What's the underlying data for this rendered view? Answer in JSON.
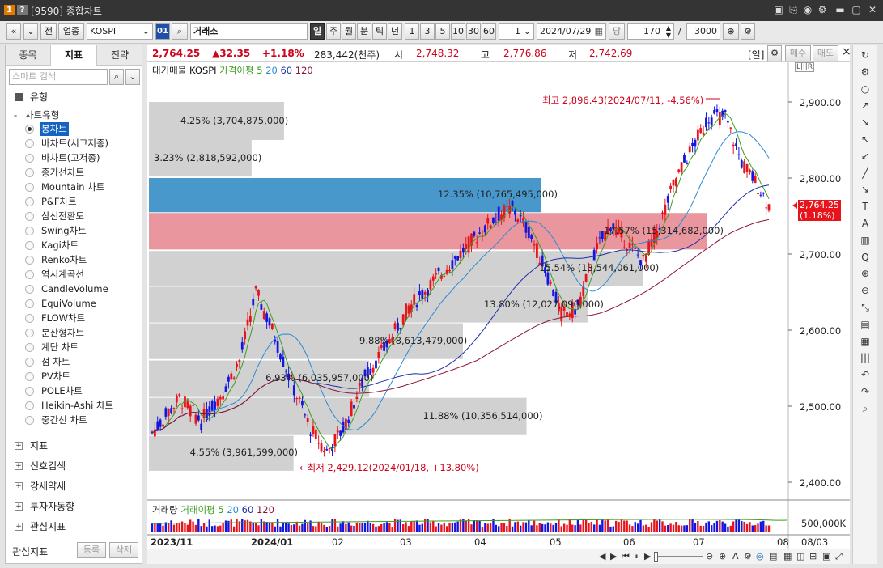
{
  "window": {
    "num1": "1",
    "num2": "?",
    "title": "[9590] 종합차트",
    "controls": [
      "▣",
      "⎘",
      "◉",
      "⚙",
      "▬",
      "▢",
      "✕"
    ]
  },
  "toolbar": {
    "nav_prev": "«",
    "nav_down": "⌄",
    "prev_btn": "전",
    "category": "업종",
    "symbol": "KOSPI",
    "code_badge": "01",
    "search_icon": "⌕",
    "market": "거래소",
    "periods": [
      "일",
      "주",
      "월",
      "분",
      "틱",
      "년"
    ],
    "active_period": "일",
    "intervals": [
      "1",
      "3",
      "5",
      "10",
      "30",
      "60"
    ],
    "step": "1",
    "date": "2024/07/29",
    "dang": "당",
    "count": "170",
    "slash": "/",
    "total": "3000"
  },
  "left_panel": {
    "tabs": [
      "종목",
      "지표",
      "전략"
    ],
    "active_tab": "지표",
    "search_placeholder": "스마트 검색",
    "section": "유형",
    "subsection": "차트유형",
    "chart_types": [
      "봉차트",
      "바차트(시고저종)",
      "바차트(고저종)",
      "종가선차트",
      "Mountain 차트",
      "P&F차트",
      "삼선전환도",
      "Swing차트",
      "Kagi차트",
      "Renko차트",
      "역시계곡선",
      "CandleVolume",
      "EquiVolume",
      "FLOW차트",
      "분산형차트",
      "계단 차트",
      "점 차트",
      "PV차트",
      "POLE차트",
      "Heikin-Ashi 차트",
      "중간선 차트"
    ],
    "selected_type": "봉차트",
    "categories": [
      "지표",
      "신호검색",
      "강세약세",
      "투자자동향",
      "관심지표"
    ],
    "bottom_label": "관심지표",
    "register_btn": "등록",
    "delete_btn": "삭제"
  },
  "quote": {
    "price": "2,764.25",
    "change": "▲32.35",
    "change_pct": "+1.18%",
    "volume": "283,442(천주)",
    "open_label": "시",
    "open": "2,748.32",
    "high_label": "고",
    "high": "2,776.86",
    "low_label": "저",
    "low": "2,742.69",
    "period_tag": "[일]",
    "buy_btn": "매수",
    "sell_btn": "매도"
  },
  "chart": {
    "legend_price": [
      "대기매물",
      "KOSPI",
      "가격이평 5",
      "20",
      "60",
      "120"
    ],
    "legend_volume": [
      "거래량",
      "거래이평 5",
      "20",
      "60",
      "120"
    ],
    "colors": {
      "up": "#e8141b",
      "down": "#1515e0",
      "ma5": "#3b9d1f",
      "ma20": "#2b8ad6",
      "ma60": "#1f2fa8",
      "ma120": "#8a1533"
    },
    "max_label": "최고 2,896.43(2024/07/11, -4.56%)",
    "min_label": "←최저 2,429.12(2024/01/18, +13.80%)",
    "current_price_tag": "2,764.25",
    "current_pct_tag": "(1.18%)",
    "vol_axis_label": "500,000K",
    "ylabels": [
      "2,900.00",
      "2,800.00",
      "2,700.00",
      "2,600.00",
      "2,500.00",
      "2,400.00"
    ],
    "xlabels": [
      "2023/11",
      "2024/01",
      "02",
      "03",
      "04",
      "05",
      "06",
      "07",
      "08",
      "08/03"
    ],
    "tag_lir": "L|I|R",
    "volume_profile": [
      {
        "label": "4.25% (3,704,875,000)",
        "pct": 4.25
      },
      {
        "label": "3.23% (2,818,592,000)",
        "pct": 3.23
      },
      {
        "label": "12.35% (10,765,495,000)",
        "pct": 12.35
      },
      {
        "label": "17.57% (15,314,682,000)",
        "pct": 17.57
      },
      {
        "label": "15.54% (13,544,061,000)",
        "pct": 15.54
      },
      {
        "label": "13.80% (12,027,090,000)",
        "pct": 13.8
      },
      {
        "label": "9.88% (8,613,479,000)",
        "pct": 9.88
      },
      {
        "label": "6.93% (6,035,957,000)",
        "pct": 6.93
      },
      {
        "label": "11.88% (10,356,514,000)",
        "pct": 11.88
      },
      {
        "label": "4.55% (3,961,599,000)",
        "pct": 4.55
      }
    ]
  },
  "right_tools": [
    "↻",
    "⚙",
    "○",
    "↗",
    "↘",
    "↖",
    "↙",
    "╱",
    "↘",
    "T",
    "A",
    "▥",
    "Q",
    "⊕",
    "⊖",
    "⤡",
    "▤",
    "▦",
    "|||",
    "↶",
    "↷",
    "⌕"
  ],
  "bottom": {
    "controls": [
      "◀",
      "▶",
      "⏮",
      "⏸",
      "▶",
      "⏭"
    ],
    "zoom": [
      "⊖",
      "⊕",
      "A",
      "⚙"
    ]
  }
}
